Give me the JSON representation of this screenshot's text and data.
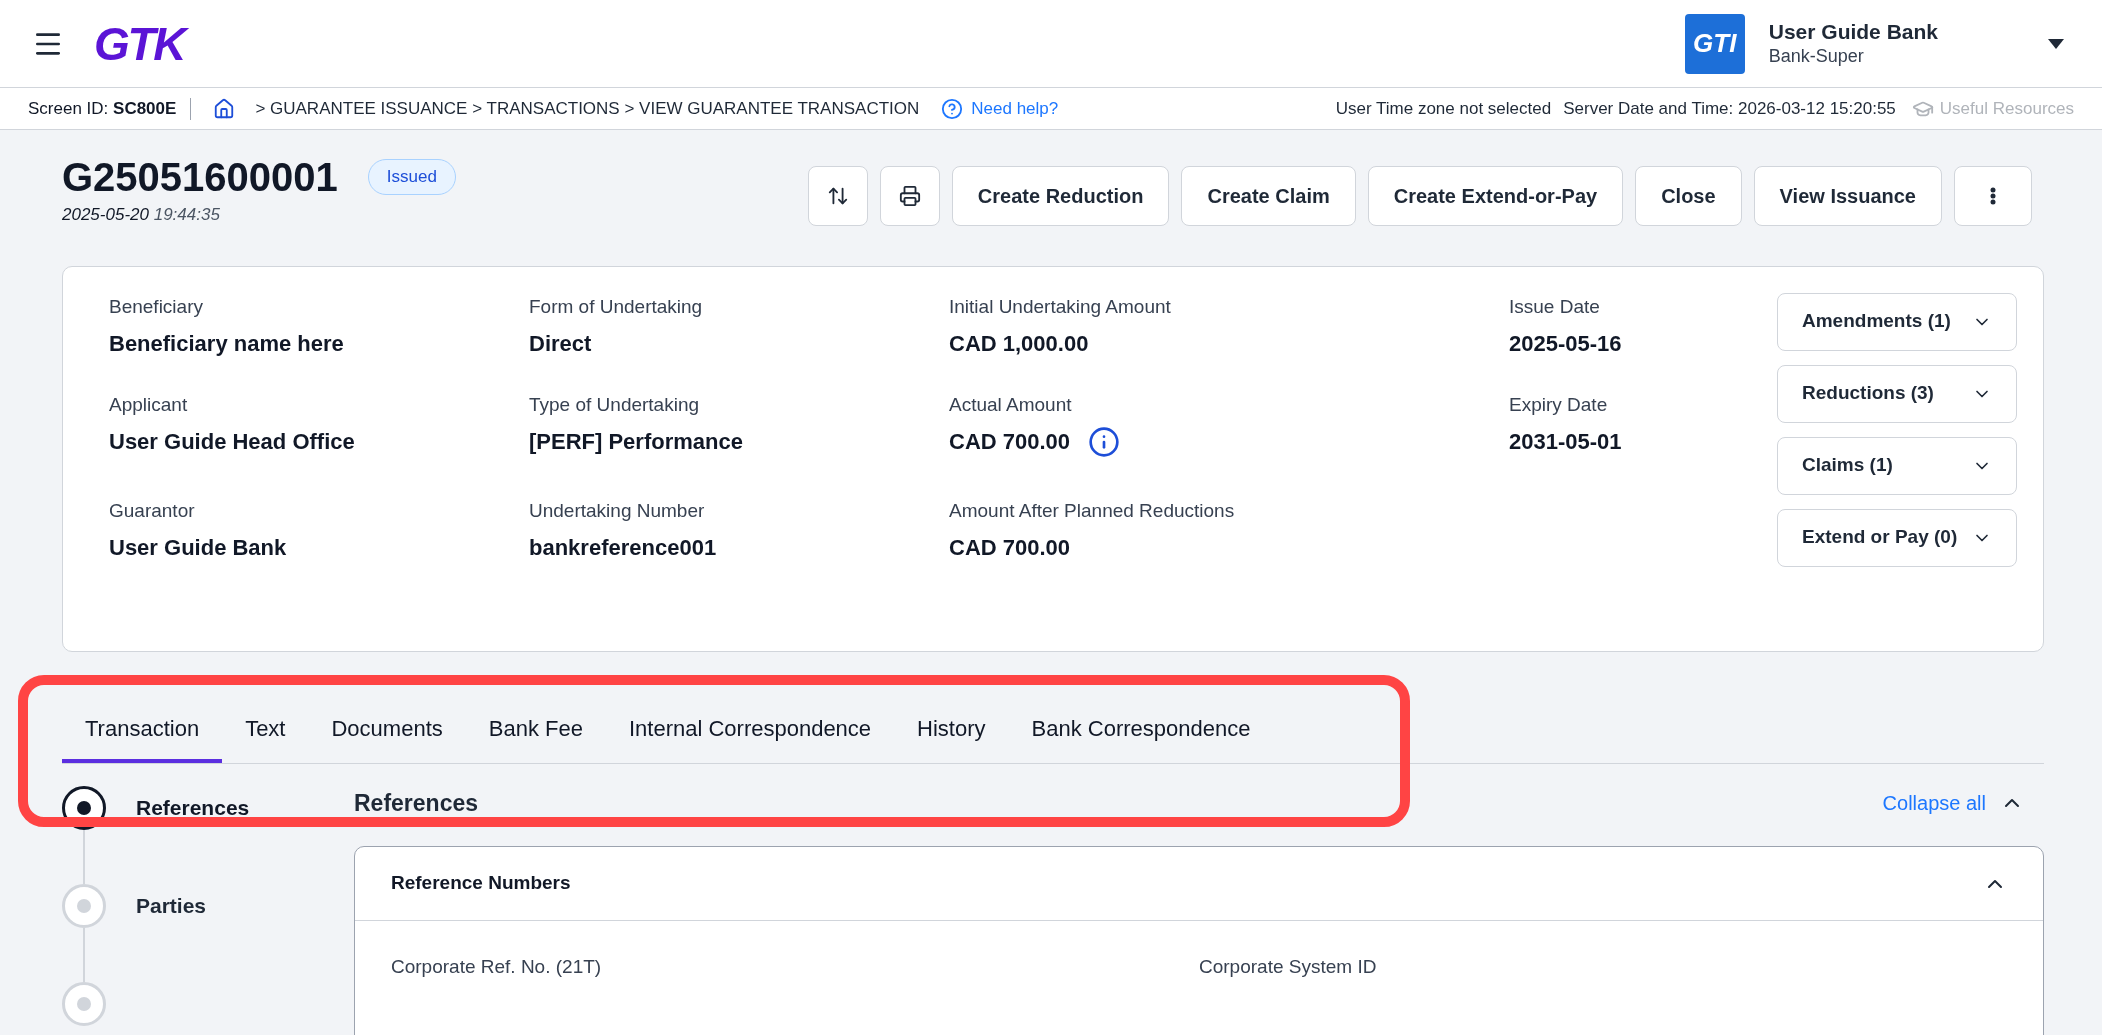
{
  "header": {
    "logo": "GTK",
    "org_badge": "GTI",
    "org_name": "User Guide Bank",
    "org_role": "Bank-Super"
  },
  "breadcrumb_bar": {
    "screen_id_label": "Screen ID:",
    "screen_id": "SC800E",
    "path": "> GUARANTEE ISSUANCE > TRANSACTIONS > VIEW GUARANTEE TRANSACTION",
    "help": "Need help?",
    "timezone": "User Time zone not selected",
    "server_time": "Server Date and Time: 2026-03-12 15:20:55",
    "resources": {
      "label": "Useful Resources",
      "disabled": true
    }
  },
  "transaction": {
    "id": "G25051600001",
    "status": "Issued",
    "date": "2025-05-20",
    "time": "19:44:35"
  },
  "actions": [
    {
      "kind": "sort"
    },
    {
      "kind": "print"
    },
    {
      "kind": "text",
      "label": "Create Reduction"
    },
    {
      "kind": "text",
      "label": "Create Claim"
    },
    {
      "kind": "text",
      "label": "Create Extend-or-Pay"
    },
    {
      "kind": "text",
      "label": "Close"
    },
    {
      "kind": "text",
      "label": "View Issuance"
    },
    {
      "kind": "more"
    }
  ],
  "summary": {
    "columns": [
      [
        {
          "label": "Beneficiary",
          "value": "Beneficiary name here"
        },
        {
          "label": "Applicant",
          "value": "User Guide Head Office"
        },
        {
          "label": "Guarantor",
          "value": "User Guide Bank"
        }
      ],
      [
        {
          "label": "Form of Undertaking",
          "value": "Direct"
        },
        {
          "label": "Type of Undertaking",
          "value": "[PERF] Performance"
        },
        {
          "label": "Undertaking Number",
          "value": "bankreference001"
        }
      ],
      [
        {
          "label": "Initial Undertaking Amount",
          "value": "CAD 1,000.00"
        },
        {
          "label": "Actual Amount",
          "value": "CAD 700.00",
          "info": true
        },
        {
          "label": "Amount After Planned Reductions",
          "value": "CAD 700.00"
        }
      ],
      [
        {
          "label": "Issue Date",
          "value": "2025-05-16"
        },
        {
          "label": "Expiry Date",
          "value": "2031-05-01"
        }
      ]
    ],
    "dropdowns": [
      "Amendments (1)",
      "Reductions (3)",
      "Claims (1)",
      "Extend or Pay (0)"
    ]
  },
  "tabs": [
    {
      "label": "Transaction",
      "selected": true
    },
    {
      "label": "Text",
      "selected": false
    },
    {
      "label": "Documents",
      "selected": false
    },
    {
      "label": "Bank Fee",
      "selected": false
    },
    {
      "label": "Internal Correspondence",
      "selected": false
    },
    {
      "label": "History",
      "selected": false
    },
    {
      "label": "Bank Correspondence",
      "selected": false
    }
  ],
  "steps": [
    {
      "label": "References",
      "selected": true
    },
    {
      "label": "Parties",
      "selected": false
    },
    {
      "selected": false
    }
  ],
  "section": {
    "title": "References",
    "collapse_all": "Collapse all",
    "panel": {
      "title": "Reference Numbers",
      "expanded": true,
      "fields": [
        "Corporate Ref. No. (21T)",
        "Corporate System ID"
      ]
    }
  }
}
